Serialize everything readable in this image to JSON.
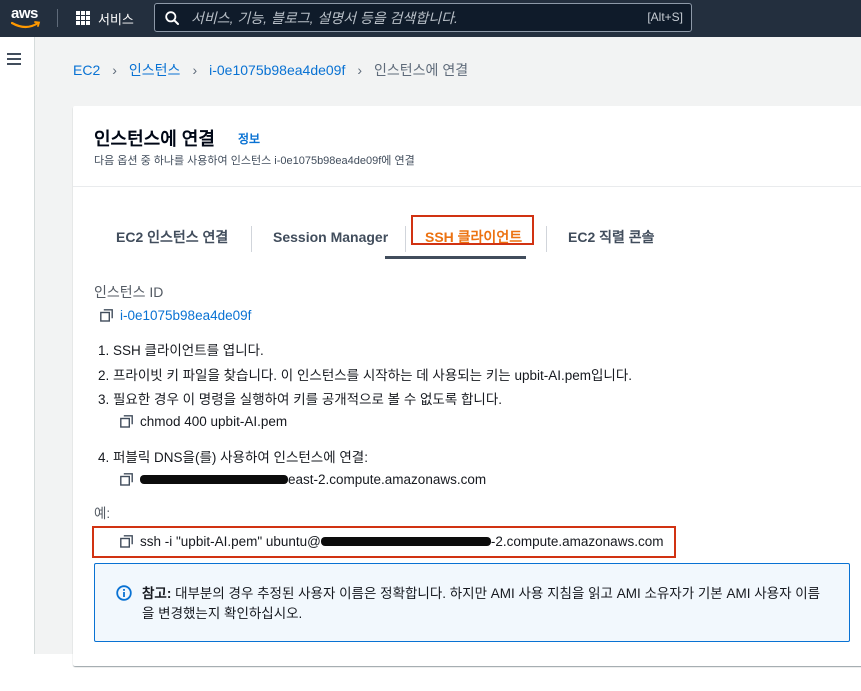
{
  "topnav": {
    "logo_text": "aws",
    "services_label": "서비스",
    "search_placeholder": "서비스, 기능, 블로그, 설명서 등을 검색합니다.",
    "search_shortcut": "[Alt+S]"
  },
  "breadcrumb": {
    "items": [
      "EC2",
      "인스턴스",
      "i-0e1075b98ea4de09f"
    ],
    "current": "인스턴스에 연결"
  },
  "header": {
    "title": "인스턴스에 연결",
    "info_link": "정보",
    "subtitle": "다음 옵션 중 하나를 사용하여 인스턴스 i-0e1075b98ea4de09f에 연결"
  },
  "tabs": [
    {
      "label": "EC2 인스턴스 연결"
    },
    {
      "label": "Session Manager"
    },
    {
      "label": "SSH 클라이언트",
      "active": true
    },
    {
      "label": "EC2 직렬 콘솔"
    }
  ],
  "content": {
    "instance_id_label": "인스턴스 ID",
    "instance_id": "i-0e1075b98ea4de09f",
    "steps": [
      "1. SSH 클라이언트를 엽니다.",
      "2. 프라이빗 키 파일을 찾습니다. 이 인스턴스를 시작하는 데 사용되는 키는 upbit-AI.pem입니다.",
      "3. 필요한 경우 이 명령을 실행하여 키를 공개적으로 볼 수 없도록 합니다.",
      "4. 퍼블릭 DNS을(를) 사용하여 인스턴스에 연결:"
    ],
    "chmod_command": "chmod 400 upbit-AI.pem",
    "dns_suffix": "east-2.compute.amazonaws.com",
    "example_label": "예:",
    "example_prefix": "ssh -i \"upbit-AI.pem\" ubuntu@",
    "example_suffix": "-2.compute.amazonaws.com"
  },
  "note": {
    "bold": "참고:",
    "text": " 대부분의 경우 추정된 사용자 이름은 정확합니다. 하지만 AMI 사용 지침을 읽고 AMI 소유자가 기본 AMI 사용자 이름을 변경했는지 확인하십시오."
  },
  "colors": {
    "nav_bg": "#232f3e",
    "link": "#0972d3",
    "active_tab": "#ec7211",
    "highlight_box": "#d13212",
    "note_bg": "#f2f8fd"
  }
}
